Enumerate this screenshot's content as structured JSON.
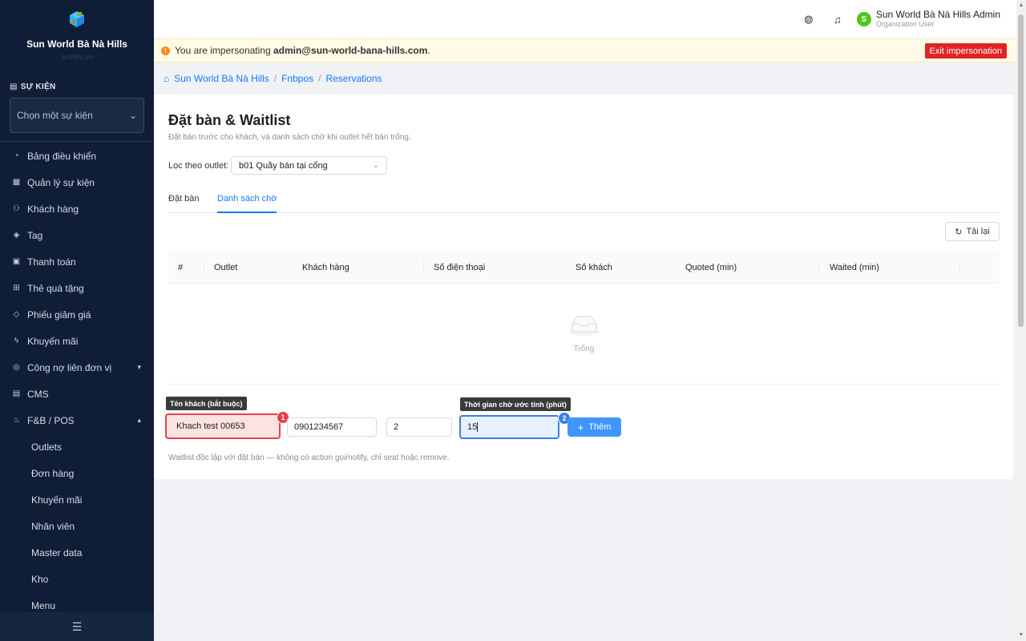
{
  "sidebar": {
    "brand": "Sun World Bà Nà Hills",
    "brand_sub": "amhills.vn",
    "section_title": "SỰ KIỆN",
    "event_placeholder": "Chọn một sự kiện",
    "items": [
      {
        "label": "Bảng điều khiển",
        "icon": "dashboard-icon"
      },
      {
        "label": "Quản lý sự kiện",
        "icon": "calendar-icon"
      },
      {
        "label": "Khách hàng",
        "icon": "users-icon"
      },
      {
        "label": "Tag",
        "icon": "tag-icon"
      },
      {
        "label": "Thanh toán",
        "icon": "payment-icon"
      },
      {
        "label": "Thẻ quà tặng",
        "icon": "gift-icon"
      },
      {
        "label": "Phiếu giảm giá",
        "icon": "coupon-icon"
      },
      {
        "label": "Khuyến mãi",
        "icon": "promotion-icon"
      },
      {
        "label": "Công nợ liên đơn vị",
        "icon": "debt-icon"
      },
      {
        "label": "CMS",
        "icon": "cms-icon"
      },
      {
        "label": "F&B / POS",
        "icon": "fnb-icon"
      }
    ],
    "subitems": [
      "Outlets",
      "Đơn hàng",
      "Khuyến mãi",
      "Nhân viên",
      "Master data",
      "Kho",
      "Menu"
    ]
  },
  "header": {
    "user_name": "Sun World Bà Nà Hills Admin",
    "user_role": "Organization User",
    "avatar_letter": "S"
  },
  "impersonation": {
    "prefix": "You are impersonating ",
    "email": "admin@sun-world-bana-hills.com",
    "suffix": ".",
    "exit_label": "Exit impersonation"
  },
  "breadcrumb": [
    "Sun World Bà Nà Hills",
    "Fnbpos",
    "Reservations"
  ],
  "page": {
    "title": "Đặt bàn & Waitlist",
    "subtitle": "Đặt bàn trước cho khách, và danh sách chờ khi outlet hết bàn trống.",
    "filter_label": "Lọc theo outlet:",
    "filter_value": "b01 Quầy bán tại cổng",
    "tabs": [
      "Đặt bàn",
      "Danh sách chờ"
    ],
    "reload_label": "Tải lại",
    "columns": [
      "#",
      "Outlet",
      "Khách hàng",
      "Số điện thoại",
      "Số khách",
      "Quoted (min)",
      "Waited (min)"
    ],
    "empty_text": "Trống"
  },
  "form": {
    "tip_name": "Tên khách (bắt buộc)",
    "tip_wait": "Thời gian chờ ước tính (phút)",
    "name_value": "Khach test 00653",
    "phone_value": "0901234567",
    "guests_value": "2",
    "wait_value": "15",
    "badge1": "1",
    "badge2": "2",
    "add_label": "Thêm",
    "hint": "Waitlist độc lập với đặt bàn — không có action gọi/notify, chỉ seat hoặc remove."
  },
  "colors": {
    "sidebar_bg": "#0f1e36",
    "accent": "#1677ff",
    "danger": "#e02424",
    "badge_red": "#e8404a",
    "badge_blue": "#3d7ee0"
  }
}
